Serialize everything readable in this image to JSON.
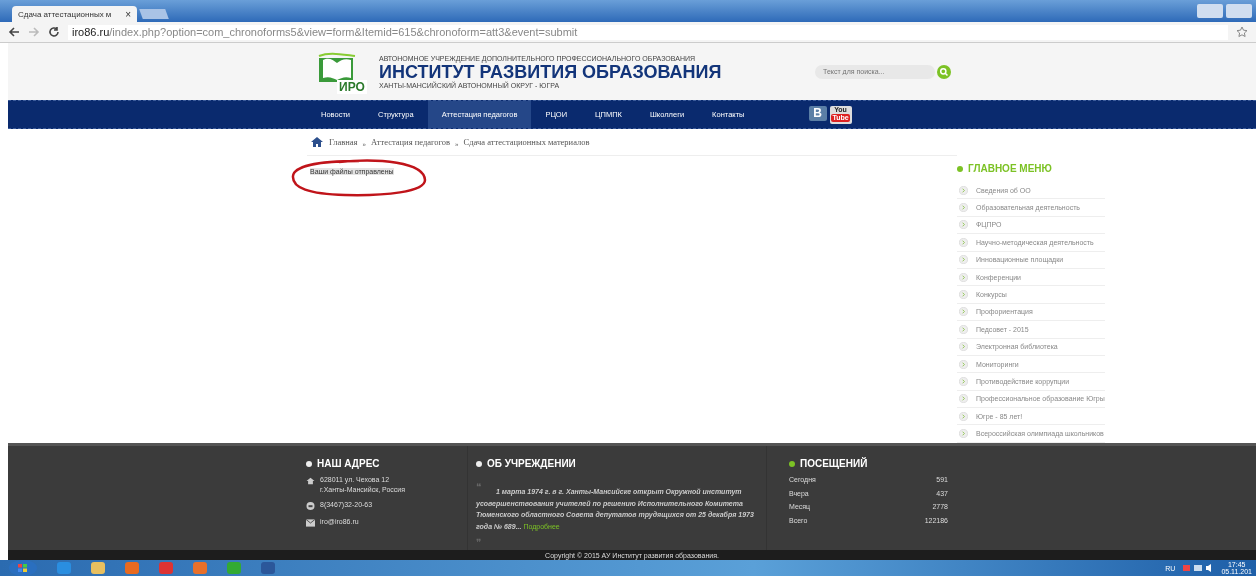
{
  "browser": {
    "tabs": [
      {
        "title": "Сдача аттестационных м",
        "selected": true
      }
    ],
    "close": "×",
    "url_host": "iro86.ru",
    "url_path": "/index.php?option=com_chronoforms5&view=form&Itemid=615&chronoform=att3&event=submit"
  },
  "header": {
    "logo_text": "ИРО",
    "org_line": "АВТОНОМНОЕ УЧРЕЖДЕНИЕ ДОПОЛНИТЕЛЬНОГО ПРОФЕССИОНАЛЬНОГО ОБРАЗОВАНИЯ",
    "title": "ИНСТИТУТ РАЗВИТИЯ ОБРАЗОВАНИЯ",
    "region": "ХАНТЫ-МАНСИЙСКИЙ АВТОНОМНЫЙ ОКРУГ - ЮГРА",
    "search": {
      "placeholder": "Текст для поиска..."
    }
  },
  "nav": {
    "items": [
      {
        "label": "Новости",
        "selected": false
      },
      {
        "label": "Структура",
        "selected": false
      },
      {
        "label": "Аттестация педагогов",
        "selected": true
      },
      {
        "label": "РЦОИ",
        "selected": false
      },
      {
        "label": "ЦПМПК",
        "selected": false
      },
      {
        "label": "Школлеги",
        "selected": false
      },
      {
        "label": "Контакты",
        "selected": false
      }
    ],
    "social": [
      {
        "kind": "vk",
        "label": "B"
      },
      {
        "kind": "youtube",
        "label": "You",
        "label2": "Tube"
      }
    ]
  },
  "breadcrumbs": [
    {
      "label": "Главная"
    },
    {
      "label": "Аттестация педагогов"
    },
    {
      "label": "Сдача аттестационных материалов"
    }
  ],
  "breadcrumb_separator": "»",
  "message": "Ваши файлы отправлены",
  "sidebar": {
    "title": "ГЛАВНОЕ МЕНЮ",
    "items": [
      "Сведения об ОО",
      "Образовательная деятельность",
      "ФЦПРО",
      "Научно-методическая деятельность",
      "Инновационные площадки",
      "Конференции",
      "Конкурсы",
      "Профориентация",
      "Педсовет - 2015",
      "Электронная библиотека",
      "Мониторинги",
      "Противодействие коррупции",
      "Профессиональное образование Югры",
      "Югре - 85 лет!",
      "Всероссийская олимпиада школьников"
    ]
  },
  "footer": {
    "address": {
      "title": "НАШ АДРЕС",
      "street": "628011 ул. Чехова 12",
      "city": "г.Ханты-Мансийск, Россия",
      "phone": "8(3467)32-20-63",
      "email": "iro@iro86.ru"
    },
    "about": {
      "title": "ОБ УЧРЕЖДЕНИИ",
      "quote_open": "❝",
      "quote_close": "❞",
      "text": "1 марта 1974 г. в г. Ханты-Мансийске открыт Окружной институт усовершенствования учителей по решению Исполнительного Комитета Тюменского областного Совета депутатов трудящихся от 25 декабря 1973 года № 689...",
      "more": "Подробнее"
    },
    "visits": {
      "title": "ПОСЕЩЕНИЙ",
      "rows": [
        {
          "label": "Сегодня",
          "value": "591"
        },
        {
          "label": "Вчера",
          "value": "437"
        },
        {
          "label": "Месяц",
          "value": "2778"
        },
        {
          "label": "Всего",
          "value": "122186"
        }
      ]
    },
    "copyright": "Copyright © 2015 АУ Институт развития образования."
  },
  "taskbar": {
    "apps": [
      {
        "kind": "ie"
      },
      {
        "kind": "explorer"
      },
      {
        "kind": "media"
      },
      {
        "kind": "chrome"
      },
      {
        "kind": "firefox"
      },
      {
        "kind": "mail"
      },
      {
        "kind": "word"
      }
    ],
    "lang": "RU",
    "time": "17:45",
    "date": "05.11.201"
  }
}
